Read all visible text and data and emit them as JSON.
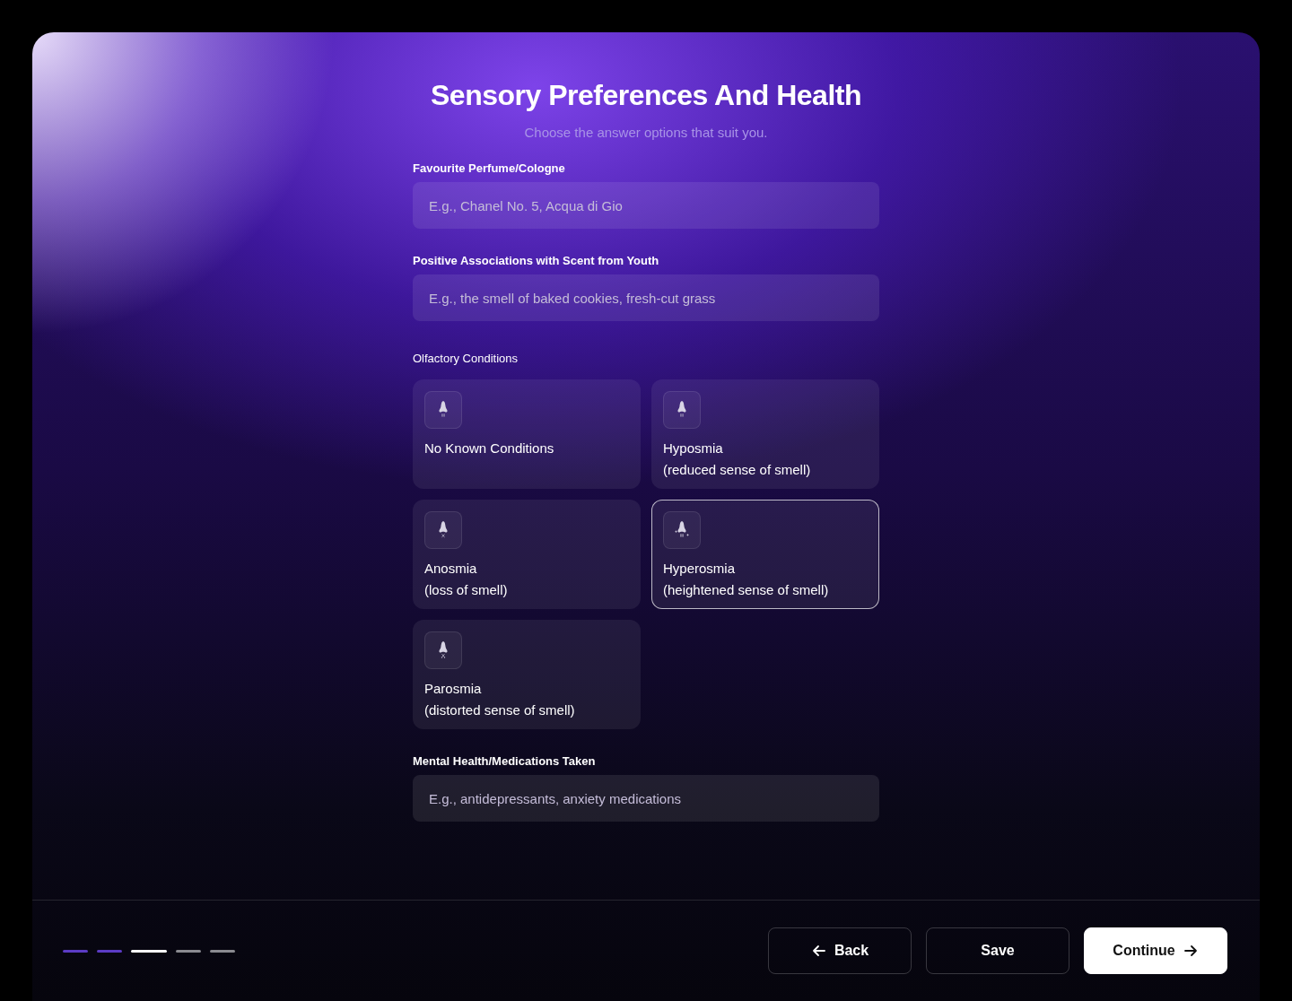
{
  "title": "Sensory Preferences And Health",
  "subtitle": "Choose the answer options that suit you.",
  "fields_top": [
    {
      "label": "Favourite Perfume/Cologne",
      "placeholder": "E.g., Chanel No. 5, Acqua di Gio"
    },
    {
      "label": "Positive Associations with Scent from Youth",
      "placeholder": "E.g., the smell of baked cookies, fresh-cut grass"
    }
  ],
  "conditions": {
    "label": "Olfactory Conditions",
    "options": [
      {
        "kind": "plain",
        "name": "No Known Conditions",
        "selected": false
      },
      {
        "kind": "plain",
        "name": "Hyposmia",
        "note": "(reduced sense of smell)",
        "selected": false
      },
      {
        "kind": "cross",
        "name": "Anosmia",
        "note": "(loss of smell)",
        "selected": false
      },
      {
        "kind": "sparkle",
        "name": "Hyperosmia",
        "note": "(heightened sense of smell)",
        "selected": true
      },
      {
        "kind": "swap",
        "name": "Parosmia",
        "note": "(distorted sense of smell)",
        "selected": false
      }
    ]
  },
  "fields_bottom": [
    {
      "label": "Mental Health/Medications Taken",
      "placeholder": "E.g., antidepressants, anxiety medications"
    }
  ],
  "progress": [
    {
      "completed": true,
      "selected": false
    },
    {
      "completed": true,
      "selected": false
    },
    {
      "completed": false,
      "selected": true
    },
    {
      "completed": false,
      "selected": false
    },
    {
      "completed": false,
      "selected": false
    }
  ],
  "buttons": [
    {
      "kind": "back",
      "label": "Back"
    },
    {
      "kind": "save",
      "label": "Save"
    },
    {
      "kind": "continue",
      "label": "Continue"
    }
  ]
}
